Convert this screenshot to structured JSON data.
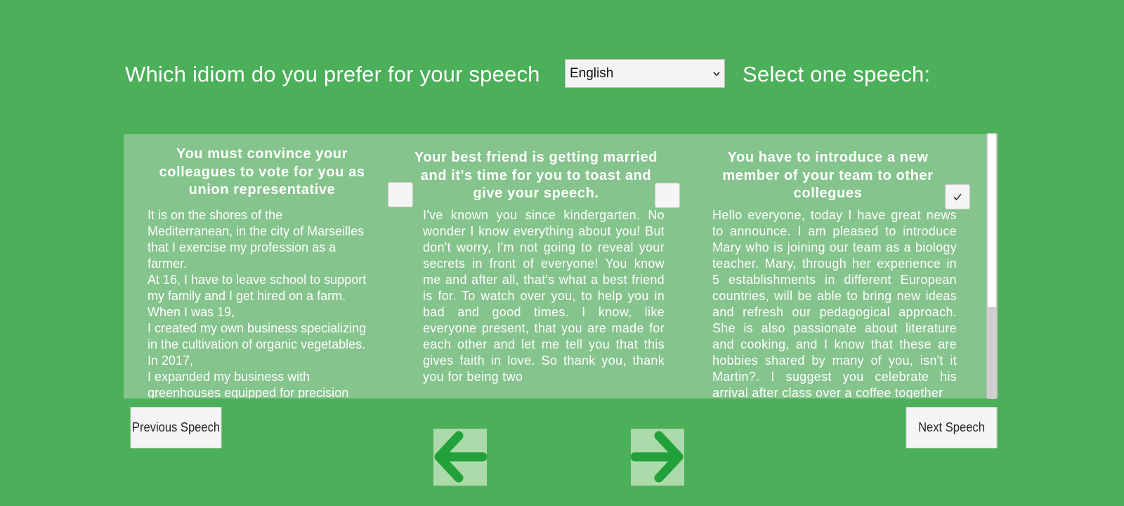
{
  "header": {
    "idiom_label": "Which idiom do you prefer for your speech",
    "language_selected": "English",
    "select_label": "Select one speech:"
  },
  "speeches": [
    {
      "title": "You must convince your colleagues to vote for you as union representative",
      "checked": false,
      "text": "It is on the shores of the\nMediterranean, in the city of Marseilles\nthat I exercise my profession as a\nfarmer.\nAt 16, I have to leave school to support\nmy family and I get hired on a farm.\nWhen I was 19,\nI created my own business specializing\nin the cultivation of organic vegetables.\nIn 2017,\nI expanded my business with\ngreenhouses equipped for precision"
    },
    {
      "title": "Your best friend is getting married and it's time for you to toast and give your speech.",
      "checked": false,
      "text": "I've known you since kindergarten. No wonder I know everything about you! But don't worry, I'm not going to reveal your secrets in front of everyone! You know me and after all, that's what a best friend is for.\nTo watch over you, to help you in bad and good times.\nI know, like everyone present, that you are made for each other and let me tell you that this gives faith in love.\nSo thank you, thank you for being two"
    },
    {
      "title": "You have to introduce a new member of your team to other collegues",
      "checked": true,
      "text": "Hello everyone, today I have great news to announce. I am pleased to introduce Mary who is joining our team as a biology teacher. Mary, through her experience in 5 establishments in different European countries, will be able to bring new ideas and refresh our pedagogical approach. She is also passionate about literature and cooking, and I know that these are hobbies shared by many of you, isn't it Martin?. I suggest you celebrate his arrival after class over a coffee together"
    }
  ],
  "nav": {
    "previous_label": "Previous Speech",
    "next_label": "Next Speech"
  },
  "colors": {
    "background": "#4caf5a",
    "panel": "#85c48c",
    "arrow": "#22a03a",
    "arrow_bg": "#acdaaa"
  },
  "icons": {
    "checkbox": "checkmark-icon",
    "select": "chevron-down-icon",
    "left": "arrow-left-icon",
    "right": "arrow-right-icon"
  }
}
